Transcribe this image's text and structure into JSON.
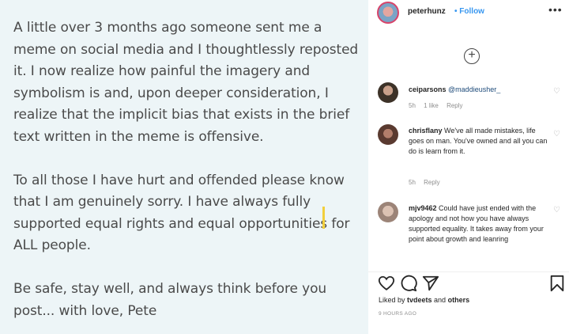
{
  "post": {
    "paragraph1": "A little over 3 months ago someone sent me a meme on social media and I thoughtlessly reposted it. I now realize how painful the imagery and symbolism is and, upon deeper consideration, I realize that the implicit bias that exists in the brief text written in the meme is offensive.",
    "paragraph2": "To all those I have hurt and offended please know that I am genuinely sorry. I have always fully supported equal rights and equal opportunities for ALL people.",
    "paragraph3": "Be safe, stay well, and always think before you post... with love, Pete"
  },
  "header": {
    "username": "peterhunz",
    "separator": "•",
    "follow_label": "Follow",
    "more_icon": "ellipsis-icon"
  },
  "load_more_icon": "plus-circle-icon",
  "comments": [
    {
      "user": "ceiparsons",
      "text": "@maddieusher_",
      "time": "5h",
      "likes": "1 like",
      "reply": "Reply"
    },
    {
      "user": "chrisflany",
      "text": "We've all made mistakes, life goes on man. You've owned and all you can do is learn from it.",
      "time": "5h",
      "reply": "Reply"
    },
    {
      "user": "mjv9462",
      "text": "Could have just ended with the apology and not how you have always supported equality. It takes away from your point about growth and leanring"
    }
  ],
  "footer": {
    "liked_prefix": "Liked by ",
    "liked_user": "tvdeets",
    "liked_and": " and ",
    "liked_others": "others",
    "timestamp": "9 HOURS AGO"
  },
  "colors": {
    "follow": "#3897f0",
    "image_bg": "#edf5f7",
    "caret": "#f2cf3d"
  }
}
